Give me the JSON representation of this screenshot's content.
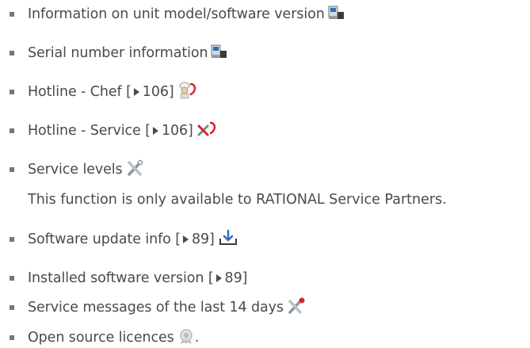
{
  "items": [
    {
      "label": "Information on unit model/software version",
      "icon": "unit-device-icon"
    },
    {
      "label": "Serial number information",
      "icon": "unit-device-icon"
    },
    {
      "label": "Hotline - Chef",
      "ref_open": "[",
      "ref_page": "106]",
      "icon": "chef-hotline-icon"
    },
    {
      "label": "Hotline - Service",
      "ref_open": "[",
      "ref_page": "106]",
      "icon": "service-hotline-icon"
    },
    {
      "label": "Service levels",
      "icon": "tools-icon"
    },
    {
      "label": "Software update info",
      "ref_open": "[",
      "ref_page": "89]",
      "icon": "download-icon"
    },
    {
      "label": "Installed software version",
      "ref_open": "[",
      "ref_page": "89]"
    },
    {
      "label": "Service messages of the last 14 days",
      "icon": "service-tools-alert-icon"
    },
    {
      "label": "Open source licences",
      "icon": "license-seal-icon",
      "suffix": "."
    }
  ],
  "service_levels_note": "This function is only available to RATIONAL Service Partners.",
  "colors": {
    "text": "#4a4a4a",
    "bullet": "#777777",
    "accent_red": "#d8232a",
    "icon_blue": "#2f6fb3"
  }
}
